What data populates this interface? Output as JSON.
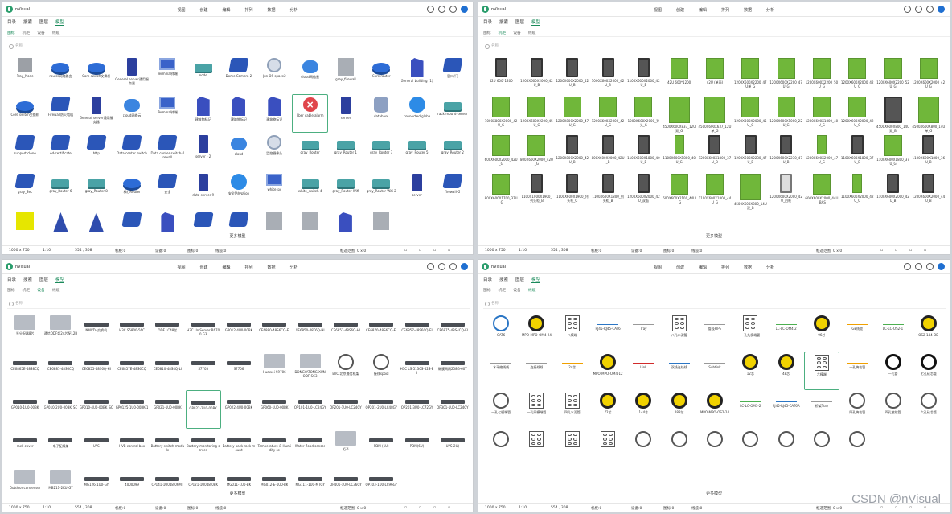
{
  "app": {
    "name": "nVisual"
  },
  "menu": [
    "视图",
    "创建",
    "编辑",
    "排列",
    "数据",
    "分析"
  ],
  "nav": [
    "目录",
    "搜索",
    "图层",
    "模型"
  ],
  "subtabs": [
    "图标",
    "机柜",
    "设备",
    "线缆"
  ],
  "search_placeholder": "名称",
  "more_label": "更多模型",
  "watermark": "CSDN @nVisual",
  "footer_a": {
    "canvas": "1000 x 750",
    "scale": "1:10",
    "coords": "554 , 308",
    "racks": "机柜:0",
    "devices": "设备:0",
    "icons": "图标:0",
    "cables": "线缆:0",
    "selection": "框选范围: 0 x 0"
  },
  "footer_b": {
    "canvas": "1000 x 750",
    "scale": "1:10",
    "coords": "554 , 308",
    "racks": "机柜:0",
    "devices": "设备:0",
    "icons": "图标:0",
    "cables": "线缆:0",
    "selection": "框选范围: 0 x 0"
  },
  "footer_c": {
    "canvas": "1000 x 750",
    "scale": "1:10",
    "coords": "554 , 308",
    "racks": "机柜:0",
    "devices": "设备:0",
    "icons": "图标:0",
    "cables": "线缆:0",
    "selection": "框选范围: 0 x 0"
  },
  "footer_d": {
    "canvas": "1000 x 750",
    "scale": "1:10",
    "coords": "554 , 308",
    "racks": "机柜:0",
    "devices": "设备:0",
    "icons": "图标:0",
    "cables": "线缆:0",
    "selection": "框选范围: 0 x 0"
  },
  "icons_panel": [
    {
      "cap": "Tray_Node",
      "icon": "tray"
    },
    {
      "cap": "router网络路由",
      "icon": "router"
    },
    {
      "cap": "Core switch交换机",
      "icon": "router"
    },
    {
      "cap": "General server通用服务器",
      "icon": "srv"
    },
    {
      "cap": "Terminal终端",
      "icon": "pc"
    },
    {
      "cap": "node",
      "icon": "lrouter"
    },
    {
      "cap": "Dome Camera 2",
      "icon": "blue3d"
    },
    {
      "cap": "Jun OS space2",
      "icon": "ap"
    },
    {
      "cap": "cloud网络云",
      "icon": "cloud"
    },
    {
      "cap": "gray_firewall",
      "icon": "gray3d"
    },
    {
      "cap": "Core router",
      "icon": "router"
    },
    {
      "cap": "General building (1)",
      "icon": "bldg"
    },
    {
      "cap": "窗口/门",
      "icon": "blue3d"
    },
    {
      "cap": "Core switch交换机",
      "icon": "router"
    },
    {
      "cap": "Firewall防火墙机",
      "icon": "blue3d"
    },
    {
      "cap": "General server通用服务器",
      "icon": "srv"
    },
    {
      "cap": "cloud网络云",
      "icon": "cloud"
    },
    {
      "cap": "Terminal终端",
      "icon": "pc"
    },
    {
      "cap": "建筑物标记",
      "icon": "bldg"
    },
    {
      "cap": "建筑物标记",
      "icon": "bldg"
    },
    {
      "cap": "建筑物标记",
      "icon": "bldg"
    },
    {
      "cap": "fiber cable alarm",
      "icon": "alarm",
      "sel": true
    },
    {
      "cap": "server",
      "icon": "srv"
    },
    {
      "cap": "database",
      "icon": "cyl"
    },
    {
      "cap": "connected-globe",
      "icon": "globe"
    },
    {
      "cap": "rack-mount-server",
      "icon": "lrouter"
    },
    {
      "cap": "support clone",
      "icon": "blue3d"
    },
    {
      "cap": "ed-certificate",
      "icon": "blue3d"
    },
    {
      "cap": "http",
      "icon": "blue3d"
    },
    {
      "cap": "Data center switch",
      "icon": "blue3d"
    },
    {
      "cap": "Data center switch-firewall",
      "icon": "blue3d"
    },
    {
      "cap": "server - 2",
      "icon": "srv"
    },
    {
      "cap": "cloud",
      "icon": "cloud"
    },
    {
      "cap": "监控摄像头",
      "icon": "ap"
    },
    {
      "cap": "gray_Router",
      "icon": "lrouter"
    },
    {
      "cap": "gray_Router 1",
      "icon": "lrouter"
    },
    {
      "cap": "gray_Router 3",
      "icon": "lrouter"
    },
    {
      "cap": "gray_Router 5",
      "icon": "lrouter"
    },
    {
      "cap": "gray_Router 2",
      "icon": "lrouter"
    },
    {
      "cap": "gray_Sec",
      "icon": "blue3d"
    },
    {
      "cap": "gray_Router 6",
      "icon": "lrouter"
    },
    {
      "cap": "gray_Router 8",
      "icon": "lrouter"
    },
    {
      "cap": "核心Router",
      "icon": "router"
    },
    {
      "cap": "安全",
      "icon": "blue3d"
    },
    {
      "cap": "data-server 9",
      "icon": "srv"
    },
    {
      "cap": "安全防护ption",
      "icon": "globe"
    },
    {
      "cap": "white_pc",
      "icon": "pc"
    },
    {
      "cap": "white_switch 4",
      "icon": "lrouter"
    },
    {
      "cap": "gray_Router Wifi",
      "icon": "lrouter"
    },
    {
      "cap": "gray_Router Wifi 2",
      "icon": "lrouter"
    },
    {
      "cap": "server",
      "icon": "srv"
    },
    {
      "cap": "firewall-G",
      "icon": "blue3d"
    },
    {
      "cap": "",
      "icon": "yel"
    },
    {
      "cap": "",
      "icon": "cone"
    },
    {
      "cap": "",
      "icon": "cone"
    },
    {
      "cap": "",
      "icon": "blue3d"
    },
    {
      "cap": "",
      "icon": "bldg"
    },
    {
      "cap": "",
      "icon": "blue3d"
    },
    {
      "cap": "",
      "icon": "blue3d"
    },
    {
      "cap": "",
      "icon": "gray3d"
    },
    {
      "cap": "",
      "icon": "gray3d"
    },
    {
      "cap": "",
      "icon": "bldg"
    },
    {
      "cap": "",
      "icon": "gray3d"
    }
  ],
  "racks_panel": [
    {
      "cap": "42U 600*1200",
      "icon": "rack"
    },
    {
      "cap": "1200X600X2000_42U_B",
      "icon": "rack"
    },
    {
      "cap": "1200X600X2000_42U_B",
      "icon": "rack"
    },
    {
      "cap": "1000X600X2000_42U_B",
      "icon": "rack"
    },
    {
      "cap": "1100X600X2000_42U_B",
      "icon": "rack"
    },
    {
      "cap": "42U 600*1200",
      "icon": "green"
    },
    {
      "cap": "42U (单面)",
      "icon": "green"
    },
    {
      "cap": "1200X600X2200_47U单_G",
      "icon": "green"
    },
    {
      "cap": "1200X600X2200_47U_G",
      "icon": "green"
    },
    {
      "cap": "1200X600X2200_50U_G",
      "icon": "green"
    },
    {
      "cap": "1200X600X2000_42U_G",
      "icon": "green"
    },
    {
      "cap": "1200X600X2200_52U_G",
      "icon": "green"
    },
    {
      "cap": "1200X600X2000_42U_G",
      "icon": "green"
    },
    {
      "cap": "1000X800X2000_42U_G",
      "icon": "green"
    },
    {
      "cap": "1200X600X2200_45U_G",
      "icon": "green"
    },
    {
      "cap": "1200X800X2200_47U_G",
      "icon": "green"
    },
    {
      "cap": "1200X600X2000_42U_G",
      "icon": "green"
    },
    {
      "cap": "1000X600X2000_列头_G",
      "icon": "green"
    },
    {
      "cap": "4500X600X837_12U双_G",
      "icon": "greent"
    },
    {
      "cap": "4500X600X637_12U单_G",
      "icon": "greent"
    },
    {
      "cap": "1200X800X2000_45U_G",
      "icon": "green"
    },
    {
      "cap": "1200X600X1000_22U_G",
      "icon": "green"
    },
    {
      "cap": "1200X600X1800_40U_G",
      "icon": "green"
    },
    {
      "cap": "1200X600X2000_42U_G",
      "icon": "green"
    },
    {
      "cap": "4500X600X800_14U双_B",
      "icon": "rackbig"
    },
    {
      "cap": "4500X600X800_14U单_G",
      "icon": "greent"
    },
    {
      "cap": "600X600X2000_42U_G",
      "icon": "green"
    },
    {
      "cap": "800X600X2000_42U_G",
      "icon": "green"
    },
    {
      "cap": "1200X800X2000_42U_B",
      "icon": "rack"
    },
    {
      "cap": "800X600X2000_42U_B",
      "icon": "rack"
    },
    {
      "cap": "1100X600X1800_40U_B",
      "icon": "rack"
    },
    {
      "cap": "1100X600X1800_40U_G",
      "icon": "greens"
    },
    {
      "cap": "1200X600X1800_37U_B",
      "icon": "rack"
    },
    {
      "cap": "1200X600X2230_47U_B",
      "icon": "rack"
    },
    {
      "cap": "1200X600X2230_47U_B",
      "icon": "rack"
    },
    {
      "cap": "1200X600X2000_47U_G",
      "icon": "greens"
    },
    {
      "cap": "1100X600X1800_37U_B",
      "icon": "rack"
    },
    {
      "cap": "1100X600X1800_37U_G",
      "icon": "green"
    },
    {
      "cap": "1100X600X1800_36U_B",
      "icon": "rack"
    },
    {
      "cap": "800X600X1700_37U_G",
      "icon": "green"
    },
    {
      "cap": "1100X1000X1900_列头柜_B",
      "icon": "rack"
    },
    {
      "cap": "1100X600X1900_列头柜_G",
      "icon": "rack"
    },
    {
      "cap": "1100X600X1800_列头柜_B",
      "icon": "rack"
    },
    {
      "cap": "1200X600X2000_42U_双面",
      "icon": "rack"
    },
    {
      "cap": "600X600X2100_44U_G",
      "icon": "green"
    },
    {
      "cap": "1100X600X1800_44U_G",
      "icon": "green"
    },
    {
      "cap": "4500X600X800_14U双_B",
      "icon": "greent"
    },
    {
      "cap": "1200X600X2000_42U_白柜",
      "icon": "rackwh"
    },
    {
      "cap": "600X600X2000_44U_BAS",
      "icon": "green"
    },
    {
      "cap": "1100X600X2000_42U_G",
      "icon": "greens"
    },
    {
      "cap": "1100X600X2000_42U_B",
      "icon": "rack"
    },
    {
      "cap": "1200X600X2000_44U_B",
      "icon": "rack"
    }
  ],
  "devices_panel": [
    {
      "cap": "光分配器8芯",
      "icon": "box"
    },
    {
      "cap": "通信ODF架24芯配12B",
      "icon": "box"
    },
    {
      "cap": "NMVDI·交换机",
      "icon": "dev"
    },
    {
      "cap": "H3C S5800-56C",
      "icon": "dev"
    },
    {
      "cap": "ODF LC48芯",
      "icon": "dev"
    },
    {
      "cap": "H3C UniServer R6700 G3",
      "icon": "dev"
    },
    {
      "cap": "GP012-4U0-00BK",
      "icon": "dev"
    },
    {
      "cap": "CE6880-48S6CQ-EI",
      "icon": "dev"
    },
    {
      "cap": "CE6850-48T6Q-HI",
      "icon": "dev"
    },
    {
      "cap": "CE6851-48S6Q-HI",
      "icon": "dev"
    },
    {
      "cap": "CE6870-48S6CQ-EI",
      "icon": "dev"
    },
    {
      "cap": "CE6857-48S6CQ-EI",
      "icon": "dev"
    },
    {
      "cap": "CE6875-48S4CQ-EI",
      "icon": "dev"
    },
    {
      "cap": "CE6865E-48S8CQ",
      "icon": "dev"
    },
    {
      "cap": "CE6881-48S6CQ",
      "icon": "dev"
    },
    {
      "cap": "CE6855-48S6Q-HI",
      "icon": "dev"
    },
    {
      "cap": "CE6857E-48S6CQ",
      "icon": "dev"
    },
    {
      "cap": "CE6810-48S4Q-LI",
      "icon": "dev"
    },
    {
      "cap": "S7703",
      "icon": "dev"
    },
    {
      "cap": "S7706",
      "icon": "dev"
    },
    {
      "cap": "Huawei S9706",
      "icon": "box"
    },
    {
      "cap": "DONGYATONG XUN ODF-SC3",
      "icon": "box"
    },
    {
      "cap": "BIIC 北京通信机架",
      "icon": "circ"
    },
    {
      "cap": "接线spool",
      "icon": "circ"
    },
    {
      "cap": "H3C LS-5130S-52S-EI",
      "icon": "dev"
    },
    {
      "cap": "碳膜网网258G-60T",
      "icon": "dev"
    },
    {
      "cap": "GP010-1U0-00BK",
      "icon": "dev"
    },
    {
      "cap": "GP010-2U0-00BK_SC",
      "icon": "dev"
    },
    {
      "cap": "GP010-4U0-00BK_SC",
      "icon": "dev"
    },
    {
      "cap": "GP0125-1U0-00BK-1",
      "icon": "dev"
    },
    {
      "cap": "GP021-1U0-00BK",
      "icon": "dev"
    },
    {
      "cap": "GP022-2U0-00BK",
      "icon": "dev",
      "sel": true
    },
    {
      "cap": "GP022-4U0-00BK",
      "icon": "dev"
    },
    {
      "cap": "GP060-1U0-00BK",
      "icon": "dev"
    },
    {
      "cap": "OP101-1U0-LC24GY",
      "icon": "dev"
    },
    {
      "cap": "OP201-1U0-LC24GY",
      "icon": "dev"
    },
    {
      "cap": "OP201-2U0-LC48GY",
      "icon": "dev"
    },
    {
      "cap": "OP201-3U0-LC72GY",
      "icon": "dev"
    },
    {
      "cap": "OP301-1U0-LC24GY",
      "icon": "dev"
    },
    {
      "cap": "rack cover",
      "icon": "dev"
    },
    {
      "cap": "电子配线架",
      "icon": "dev"
    },
    {
      "cap": "UPS",
      "icon": "dev"
    },
    {
      "cap": "HVB control box",
      "icon": "dev"
    },
    {
      "cap": "Battery switch module",
      "icon": "dev"
    },
    {
      "cap": "Battery monitoring screen",
      "icon": "dev"
    },
    {
      "cap": "Battery pack rack mount",
      "icon": "dev"
    },
    {
      "cap": "Temperature & Humidity se",
      "icon": "dev"
    },
    {
      "cap": "Water flood sensor",
      "icon": "dev"
    },
    {
      "cap": "柜子",
      "icon": "boxd"
    },
    {
      "cap": "PDM (1U)",
      "icon": "dev"
    },
    {
      "cap": "PDM(6U)",
      "icon": "dev"
    },
    {
      "cap": "UPS(2U)",
      "icon": "dev"
    },
    {
      "cap": "Outdoor condenser",
      "icon": "boxb"
    },
    {
      "cap": "MB211-2KU-GY",
      "icon": "box"
    },
    {
      "cap": "MG126-1U0-GY",
      "icon": "dev"
    },
    {
      "cap": "4000099",
      "icon": "dev"
    },
    {
      "cap": "CP141-1U048-06MT",
      "icon": "dev"
    },
    {
      "cap": "CP121-1U048-08K",
      "icon": "dev"
    },
    {
      "cap": "MG011-1U0-BK",
      "icon": "dev"
    },
    {
      "cap": "MG012-E-1U0-BK",
      "icon": "dev"
    },
    {
      "cap": "MG111-1U0-MTGY",
      "icon": "dev"
    },
    {
      "cap": "OP401-1U0-LC36GY",
      "icon": "dev"
    },
    {
      "cap": "OP103-1U0-LC96GY",
      "icon": "dev"
    }
  ],
  "cables_panel": [
    {
      "cap": "CAT6",
      "icon": "fibbl"
    },
    {
      "cap": "MPO-MPO-OM4-24",
      "icon": "fib"
    },
    {
      "cap": "八模端",
      "icon": "sq6"
    },
    {
      "cap": "RJ45-RJ45-CAT6",
      "icon": "lineb"
    },
    {
      "cap": "Tray",
      "icon": "linegray"
    },
    {
      "cap": "八孔水泥管",
      "icon": "sq6"
    },
    {
      "cap": "管段PIPE",
      "icon": "linegray"
    },
    {
      "cap": "一孔九模端管",
      "icon": "sq6"
    },
    {
      "cap": "LC-LC-OM4-2",
      "icon": "lineg"
    },
    {
      "cap": "96芯",
      "icon": "fib"
    },
    {
      "cap": "GE线缆",
      "icon": "lineo"
    },
    {
      "cap": "LC-LC-OS2-1",
      "icon": "lineg"
    },
    {
      "cap": "OS2-144-OD",
      "icon": "fib"
    },
    {
      "cap": "水平编线线",
      "icon": "linegray"
    },
    {
      "cap": "连接线线",
      "icon": "linegray"
    },
    {
      "cap": "24芯",
      "icon": "lineo"
    },
    {
      "cap": "MPO-MPO-OM4-12",
      "icon": "fib"
    },
    {
      "cap": "Link",
      "icon": "liner"
    },
    {
      "cap": "双线连线线",
      "icon": "lineb"
    },
    {
      "cap": "Subtink",
      "icon": "linegray"
    },
    {
      "cap": "12芯",
      "icon": "fib"
    },
    {
      "cap": "48芯",
      "icon": "fib"
    },
    {
      "cap": "六模端",
      "icon": "sq6",
      "sel": true
    },
    {
      "cap": "一孔梅花管",
      "icon": "lineo"
    },
    {
      "cap": "一孔管",
      "icon": "fibrg"
    },
    {
      "cap": "七孔硅芯管",
      "icon": "fibrg"
    },
    {
      "cap": "一孔七模端管",
      "icon": "fibw"
    },
    {
      "cap": "一孔四模端管",
      "icon": "sq6"
    },
    {
      "cap": "四孔水泥管",
      "icon": "sq6"
    },
    {
      "cap": "72芯",
      "icon": "fib"
    },
    {
      "cap": "144芯",
      "icon": "fib"
    },
    {
      "cap": "288芯",
      "icon": "fib"
    },
    {
      "cap": "MPO-MPO-OS2-24",
      "icon": "fib"
    },
    {
      "cap": "LC-LC-OM3-2",
      "icon": "lineg"
    },
    {
      "cap": "RJ45-RJ45-CAT6A",
      "icon": "lineb"
    },
    {
      "cap": "桥架Tray",
      "icon": "linegray"
    },
    {
      "cap": "四孔梅花管",
      "icon": "fibw"
    },
    {
      "cap": "四孔波纹管",
      "icon": "fibw"
    },
    {
      "cap": "六孔硅芯管",
      "icon": "fibw"
    },
    {
      "cap": "",
      "icon": "fibw"
    },
    {
      "cap": "",
      "icon": "sq6"
    },
    {
      "cap": "",
      "icon": "sq6"
    },
    {
      "cap": "",
      "icon": "sq6"
    },
    {
      "cap": "",
      "icon": "fibw"
    },
    {
      "cap": "",
      "icon": "fibw"
    },
    {
      "cap": "",
      "icon": "fibw"
    },
    {
      "cap": "",
      "icon": "fibw"
    },
    {
      "cap": "",
      "icon": "fibw"
    },
    {
      "cap": "",
      "icon": "fibw"
    },
    {
      "cap": "",
      "icon": "fibw"
    }
  ]
}
